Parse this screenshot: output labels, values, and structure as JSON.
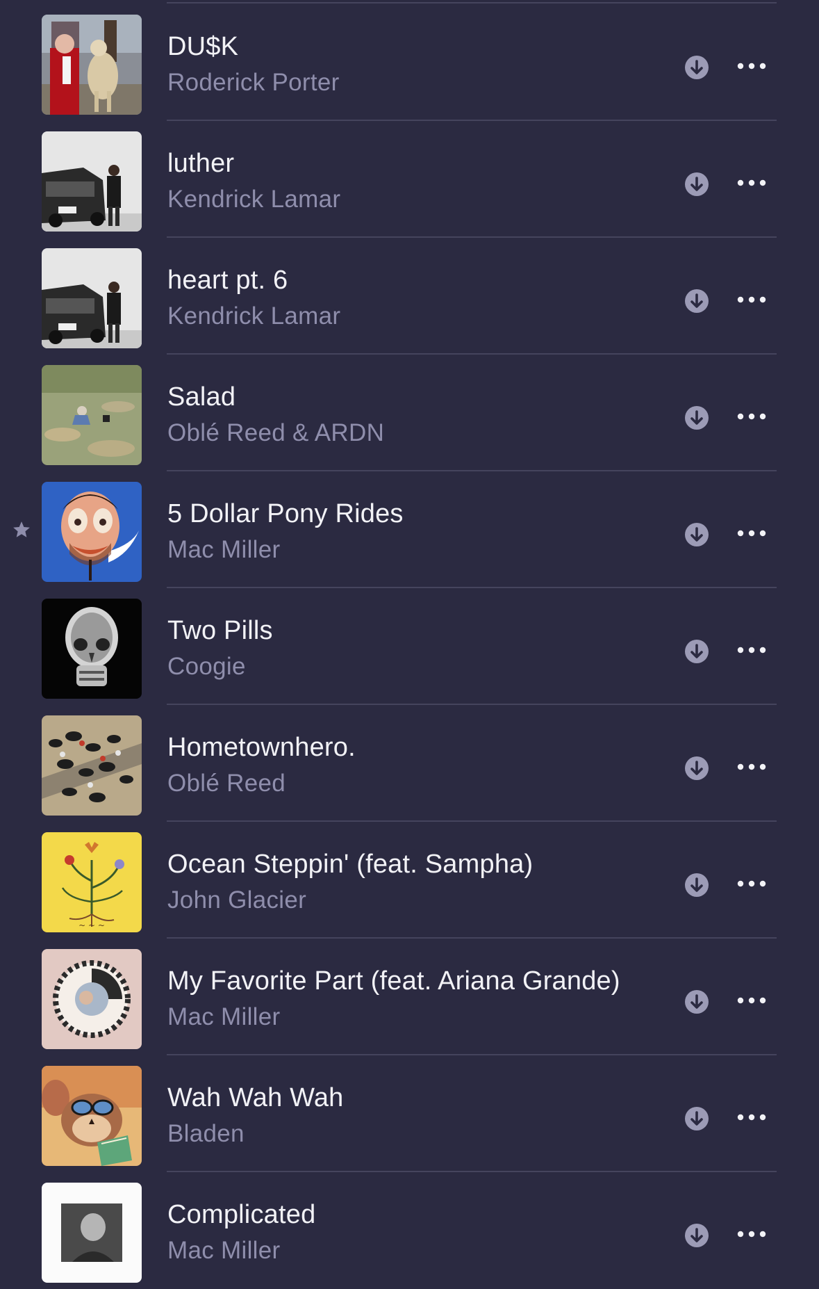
{
  "tracks": [
    {
      "title": "DU$K",
      "artist": "Roderick Porter",
      "favorite": false,
      "art": "dusk-art"
    },
    {
      "title": "luther",
      "artist": "Kendrick Lamar",
      "favorite": false,
      "art": "gnx-art"
    },
    {
      "title": "heart pt. 6",
      "artist": "Kendrick Lamar",
      "favorite": false,
      "art": "gnx-art"
    },
    {
      "title": "Salad",
      "artist": "Oblé Reed & ARDN",
      "favorite": false,
      "art": "salad-art"
    },
    {
      "title": "5 Dollar Pony Rides",
      "artist": "Mac Miller",
      "favorite": true,
      "art": "divine-feminine-art"
    },
    {
      "title": "Two Pills",
      "artist": "Coogie",
      "favorite": false,
      "art": "skull-xray-art"
    },
    {
      "title": "Hometownhero.",
      "artist": "Oblé Reed",
      "favorite": false,
      "art": "crowd-art"
    },
    {
      "title": "Ocean Steppin' (feat. Sampha)",
      "artist": "John Glacier",
      "favorite": false,
      "art": "like-a-ribbon-art"
    },
    {
      "title": "My Favorite Part (feat. Ariana Grande)",
      "artist": "Mac Miller",
      "favorite": false,
      "art": "divine-feminine-circle-art"
    },
    {
      "title": "Wah Wah Wah",
      "artist": "Bladen",
      "favorite": false,
      "art": "cartoon-mouse-art"
    },
    {
      "title": "Complicated",
      "artist": "Mac Miller",
      "favorite": false,
      "art": "circles-art"
    }
  ],
  "colors": {
    "background": "#2b2a41",
    "title_text": "#f2f2f6",
    "artist_text": "#8f8eac",
    "icon": "#9c9bb6",
    "separator": "#45445d"
  },
  "icons": {
    "download": "arrow-down-circle-icon",
    "more": "ellipsis-icon",
    "favorite": "star-icon"
  }
}
